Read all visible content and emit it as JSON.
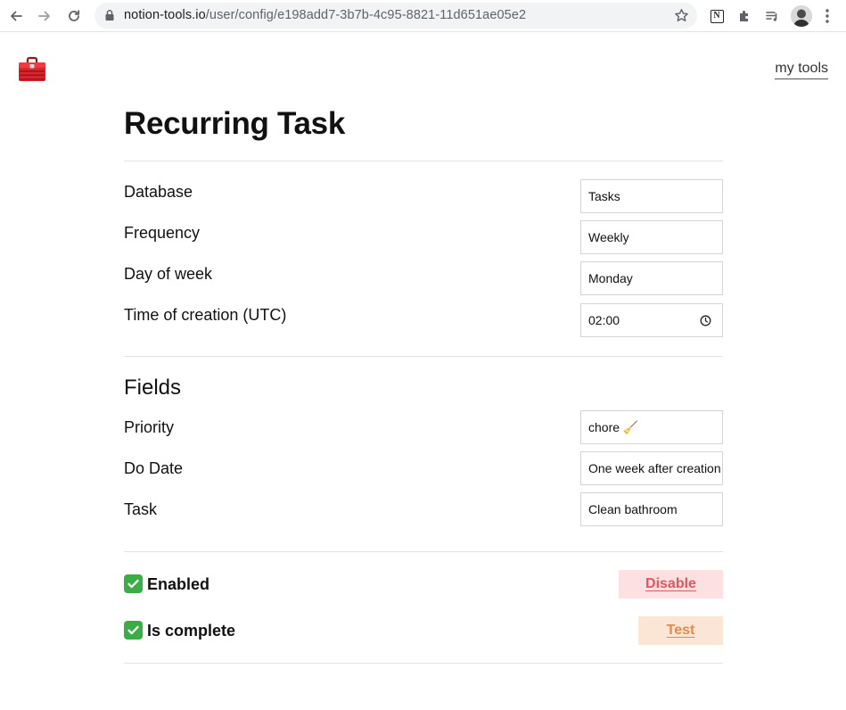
{
  "browser": {
    "url_host": "notion-tools.io",
    "url_path": "/user/config/e198add7-3b7b-4c95-8821-11d651ae05e2"
  },
  "header": {
    "my_tools_label": "my tools"
  },
  "page": {
    "title": "Recurring Task"
  },
  "settings": [
    {
      "label": "Database",
      "value": "Tasks"
    },
    {
      "label": "Frequency",
      "value": "Weekly"
    },
    {
      "label": "Day of week",
      "value": "Monday"
    },
    {
      "label": "Time of creation (UTC)",
      "value": "02:00"
    }
  ],
  "fields_section": {
    "title": "Fields",
    "items": [
      {
        "label": "Priority",
        "value": "chore 🧹"
      },
      {
        "label": "Do Date",
        "value": "One week after creation"
      },
      {
        "label": "Task",
        "value": "Clean bathroom"
      }
    ]
  },
  "status": {
    "enabled_label": "Enabled",
    "disable_button": "Disable",
    "complete_label": "Is complete",
    "test_button": "Test"
  },
  "colors": {
    "disable_bg": "#fde0e1",
    "disable_text": "#e0575f",
    "test_bg": "#fbe6d6",
    "test_text": "#e5894a",
    "check_green": "#3aad47"
  }
}
